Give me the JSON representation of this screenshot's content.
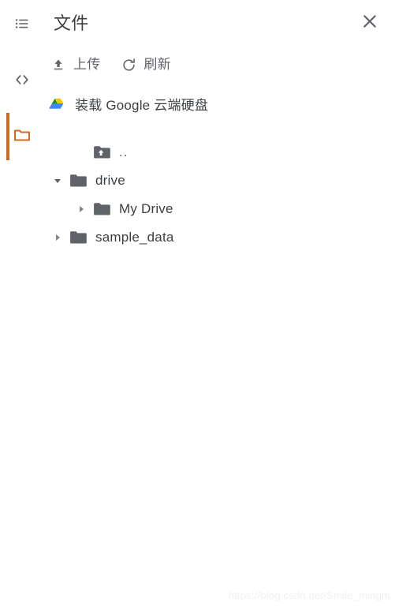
{
  "window": {
    "title": "文件"
  },
  "colors": {
    "accent": "#d2691e",
    "text_primary": "#3c4043",
    "text_secondary": "#5f6368",
    "background": "#ffffff",
    "folder_icon": "#5f6368",
    "watermark": "#f0f0f0"
  },
  "rail": {
    "items": [
      {
        "icon": "list-icon",
        "name": "table-of-contents",
        "active": false
      },
      {
        "icon": "code-brackets-icon",
        "name": "code-snippets",
        "active": false
      },
      {
        "icon": "folder-icon",
        "name": "files",
        "active": true
      }
    ]
  },
  "header": {
    "title": "文件",
    "close_label": "×",
    "close_icon": "close-icon"
  },
  "toolbar": {
    "buttons": [
      {
        "label": "上传",
        "icon": "upload-icon"
      },
      {
        "label": "刷新",
        "icon": "refresh-icon"
      }
    ]
  },
  "mount_drive": {
    "label": "装载 Google 云端硬盘",
    "icon": "google-drive-icon"
  },
  "tree": {
    "nodes": [
      {
        "label": "..",
        "icon": "folder-up-icon",
        "indent": 1,
        "twisty": "none",
        "expanded": false
      },
      {
        "label": "drive",
        "icon": "folder-icon",
        "indent": 0,
        "twisty": "down",
        "expanded": true
      },
      {
        "label": "My Drive",
        "icon": "folder-icon",
        "indent": 1,
        "twisty": "right",
        "expanded": false
      },
      {
        "label": "sample_data",
        "icon": "folder-icon",
        "indent": 0,
        "twisty": "right",
        "expanded": false
      }
    ]
  },
  "watermark": {
    "text": "https://blog.csdn.net/Smile_mingm"
  }
}
